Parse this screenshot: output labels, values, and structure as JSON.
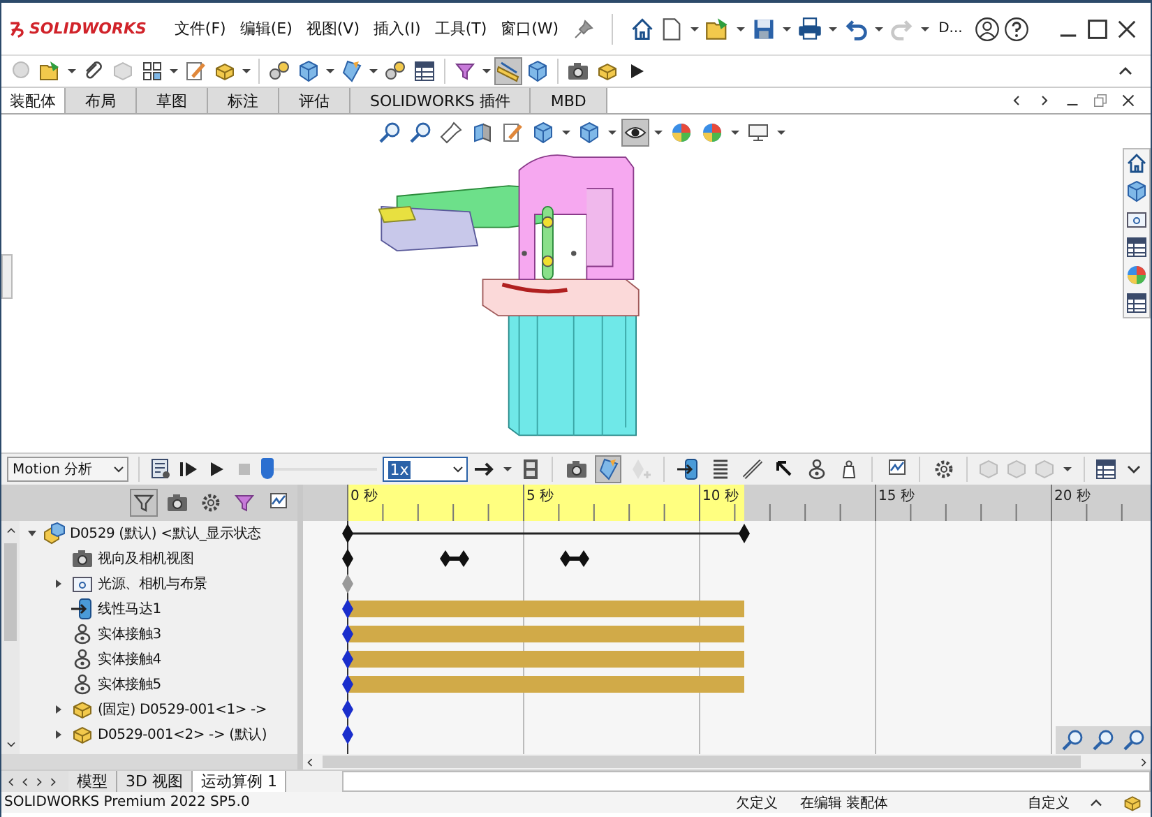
{
  "app": {
    "logo": "SOLIDWORKS",
    "menus": [
      "文件(F)",
      "编辑(E)",
      "视图(V)",
      "插入(I)",
      "工具(T)",
      "窗口(W)"
    ],
    "document_label": "D..."
  },
  "toolbar": {
    "buttons": [
      {
        "pressed": false
      },
      {
        "pressed": false
      },
      {
        "pressed": false
      },
      {
        "pressed": false
      },
      {
        "pressed": false
      },
      {
        "pressed": false
      },
      {
        "pressed": false
      },
      {
        "pressed": false
      },
      {
        "pressed": false
      },
      {
        "pressed": false
      },
      {
        "pressed": false
      },
      {
        "pressed": false
      },
      {
        "pressed": false
      },
      {
        "pressed": true
      },
      {
        "pressed": false
      },
      {
        "pressed": false
      },
      {
        "pressed": false
      },
      {
        "pressed": false
      }
    ]
  },
  "tabs": [
    {
      "label": "装配体",
      "selected": true
    },
    {
      "label": "布局",
      "selected": false
    },
    {
      "label": "草图",
      "selected": false
    },
    {
      "label": "标注",
      "selected": false
    },
    {
      "label": "评估",
      "selected": false
    },
    {
      "label": "SOLIDWORKS 插件",
      "selected": false
    },
    {
      "label": "MBD",
      "selected": false
    }
  ],
  "view_toolbar": {
    "buttons": [
      {
        "pressed": false
      },
      {
        "pressed": false
      },
      {
        "pressed": false
      },
      {
        "pressed": false
      },
      {
        "pressed": false
      },
      {
        "pressed": false
      },
      {
        "pressed": false
      },
      {
        "pressed": true
      },
      {
        "pressed": false
      },
      {
        "pressed": false
      },
      {
        "pressed": false
      }
    ]
  },
  "motion_toolbar": {
    "study_type": "Motion 分析",
    "playback": {
      "level": 0.0
    },
    "speed": "1x",
    "buttons": [
      {
        "pressed": false
      },
      {
        "pressed": true
      },
      {
        "pressed": false
      },
      {
        "pressed": false
      },
      {
        "pressed": false
      },
      {
        "pressed": false
      },
      {
        "pressed": false
      },
      {
        "pressed": false
      },
      {
        "pressed": false
      },
      {
        "pressed": false
      },
      {
        "pressed": false
      }
    ]
  },
  "tree": {
    "filters": [
      {
        "pressed": true
      },
      {
        "pressed": false
      },
      {
        "pressed": false
      },
      {
        "pressed": false
      },
      {
        "pressed": false
      }
    ],
    "items": [
      {
        "label": "D0529 (默认) <默认_显示状态",
        "kind": "span",
        "expanded": true,
        "children": [
          {
            "label": "视向及相机视图",
            "kind": "markers"
          },
          {
            "label": "光源、相机与布景",
            "kind": "pending",
            "expanded": false
          },
          {
            "label": "线性马达1",
            "kind": "bar"
          },
          {
            "label": "实体接触3",
            "kind": "bar"
          },
          {
            "label": "实体接触4",
            "kind": "bar"
          },
          {
            "label": "实体接触5",
            "kind": "bar"
          },
          {
            "label": "(固定) D0529-001<1> ->",
            "kind": "key",
            "expanded": false
          },
          {
            "label": "D0529-001<2> -> (默认)",
            "kind": "key",
            "expanded": false
          }
        ]
      }
    ]
  },
  "timeline": {
    "ticks": [
      "0 秒",
      "5 秒",
      "10 秒",
      "15 秒",
      "20 秒"
    ]
  },
  "bottom_tabs": [
    {
      "label": "模型",
      "selected": false
    },
    {
      "label": "3D 视图",
      "selected": false
    },
    {
      "label": "运动算例 1",
      "selected": true
    }
  ],
  "status_bar": {
    "product": "SOLIDWORKS Premium 2022 SP5.0",
    "definition": "欠定义",
    "mode": "在编辑 装配体",
    "units": "自定义"
  }
}
